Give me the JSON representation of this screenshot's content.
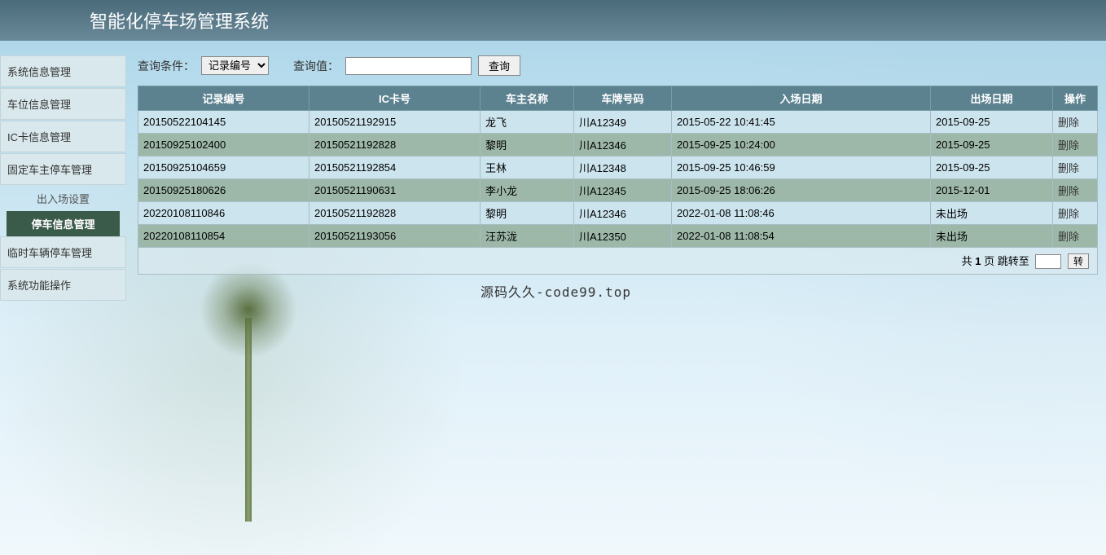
{
  "header": {
    "title": "智能化停车场管理系统"
  },
  "sidebar": {
    "items": [
      {
        "label": "系统信息管理"
      },
      {
        "label": "车位信息管理"
      },
      {
        "label": "IC卡信息管理"
      },
      {
        "label": "固定车主停车管理"
      },
      {
        "label": "临时车辆停车管理"
      },
      {
        "label": "系统功能操作"
      }
    ],
    "subitems": [
      {
        "label": "出入场设置",
        "active": false
      },
      {
        "label": "停车信息管理",
        "active": true
      }
    ]
  },
  "query": {
    "cond_label": "查询条件：",
    "select_value": "记录编号",
    "value_label": "查询值：",
    "input_value": "",
    "btn": "查询"
  },
  "table": {
    "headers": [
      "记录编号",
      "IC卡号",
      "车主名称",
      "车牌号码",
      "入场日期",
      "出场日期",
      "操作"
    ],
    "op_label": "删除",
    "rows": [
      {
        "id": "20150522104145",
        "card": "20150521192915",
        "owner": "龙飞",
        "plate": "川A12349",
        "in": "2015-05-22 10:41:45",
        "out": "2015-09-25"
      },
      {
        "id": "20150925102400",
        "card": "20150521192828",
        "owner": "黎明",
        "plate": "川A12346",
        "in": "2015-09-25 10:24:00",
        "out": "2015-09-25"
      },
      {
        "id": "20150925104659",
        "card": "20150521192854",
        "owner": "王林",
        "plate": "川A12348",
        "in": "2015-09-25 10:46:59",
        "out": "2015-09-25"
      },
      {
        "id": "20150925180626",
        "card": "20150521190631",
        "owner": "李小龙",
        "plate": "川A12345",
        "in": "2015-09-25 18:06:26",
        "out": "2015-12-01"
      },
      {
        "id": "20220108110846",
        "card": "20150521192828",
        "owner": "黎明",
        "plate": "川A12346",
        "in": "2022-01-08 11:08:46",
        "out": "未出场"
      },
      {
        "id": "20220108110854",
        "card": "20150521193056",
        "owner": "汪苏泷",
        "plate": "川A12350",
        "in": "2022-01-08 11:08:54",
        "out": "未出场"
      }
    ]
  },
  "pager": {
    "prefix": "共 ",
    "total_pages": "1",
    "suffix": " 页 跳转至",
    "jump_value": "",
    "jump_btn": "转"
  },
  "watermark": "源码久久-code99.top"
}
